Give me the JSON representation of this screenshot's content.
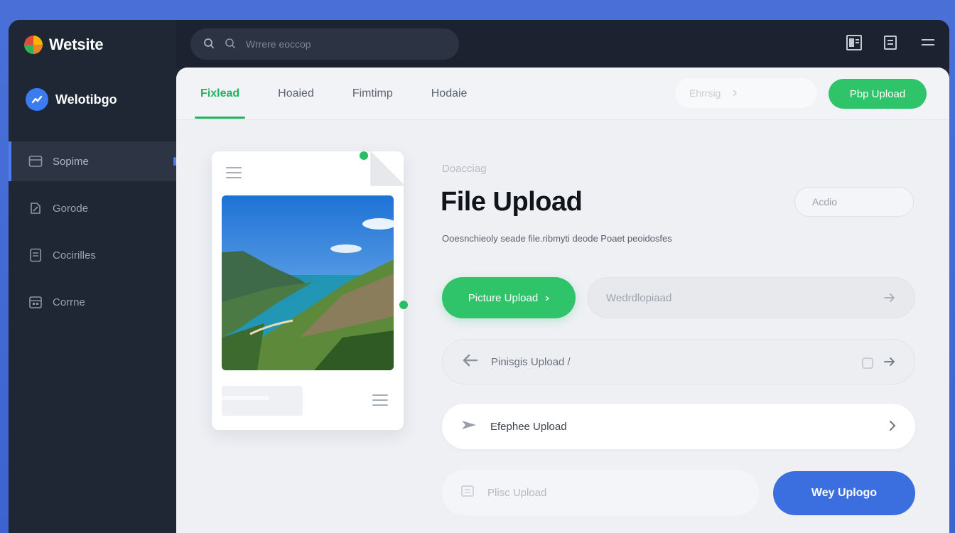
{
  "app": {
    "title": "Wetsite"
  },
  "brand": {
    "name": "Welotibgo"
  },
  "sidebar": {
    "items": [
      {
        "label": "Sopime",
        "icon": "folder-icon"
      },
      {
        "label": "Gorode",
        "icon": "edit-icon"
      },
      {
        "label": "Cocirilles",
        "icon": "document-icon"
      },
      {
        "label": "Corrne",
        "icon": "calendar-icon"
      }
    ]
  },
  "search": {
    "placeholder": "Wrrere eoccop"
  },
  "tabs": [
    {
      "label": "Fixlead"
    },
    {
      "label": "Hoaied"
    },
    {
      "label": "Fimtimp"
    },
    {
      "label": "Hodaie"
    }
  ],
  "tab_search": {
    "placeholder": "Ehrrsig"
  },
  "top_upload_button": {
    "label": "Pbp Upload"
  },
  "content": {
    "overline": "Doacciag",
    "title": "File Upload",
    "description": "Ooesnchieoly seade file.ribmyti deode Poaet peoidosfes",
    "apply_label": "Acdio"
  },
  "picture_upload_button": {
    "label": "Picture Upload"
  },
  "file_field": {
    "placeholder": "Wedrdlopiaad"
  },
  "rows": [
    {
      "label": "Pinisgis Upload /"
    },
    {
      "label": "Efephee Upload"
    },
    {
      "label": "Plisc Upload"
    }
  ],
  "way_upload_button": {
    "label": "Wey Uplogo"
  },
  "colors": {
    "accent_green": "#2fc36a",
    "accent_blue": "#3b6fe0",
    "sidebar_bg": "#1f2634",
    "panel_bg": "#eef0f4"
  }
}
